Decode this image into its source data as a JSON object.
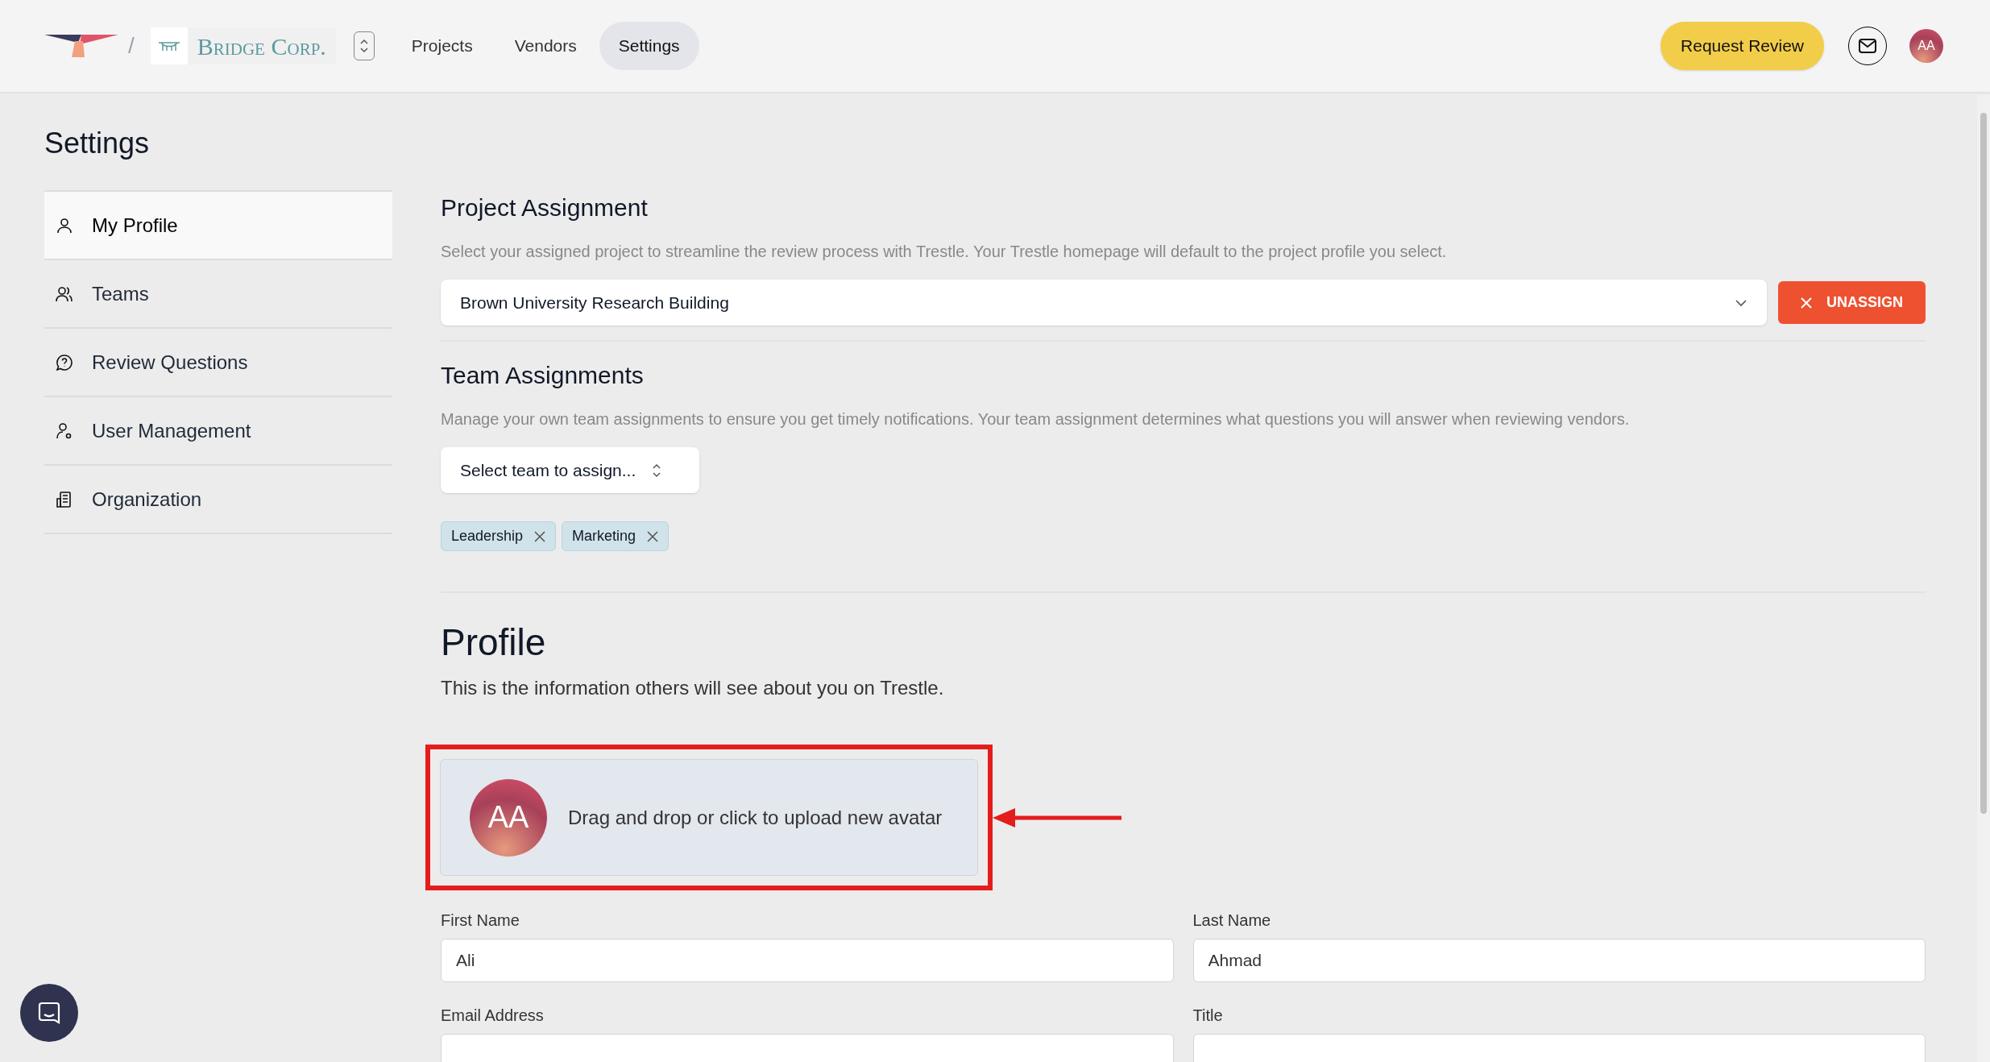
{
  "header": {
    "org_name": "Bridge Corp.",
    "breadcrumb_separator": "/",
    "nav": [
      {
        "label": "Projects",
        "selected": false
      },
      {
        "label": "Vendors",
        "selected": false
      },
      {
        "label": "Settings",
        "selected": true
      }
    ],
    "request_button": "Request Review",
    "avatar_initials": "AA"
  },
  "sidebar": {
    "title": "Settings",
    "items": [
      {
        "label": "My Profile",
        "selected": true
      },
      {
        "label": "Teams",
        "selected": false
      },
      {
        "label": "Review Questions",
        "selected": false
      },
      {
        "label": "User Management",
        "selected": false
      },
      {
        "label": "Organization",
        "selected": false
      }
    ]
  },
  "project_assignment": {
    "title": "Project Assignment",
    "description": "Select your assigned project to streamline the review process with Trestle. Your Trestle homepage will default to the project profile you select.",
    "value": "Brown University Research Building",
    "unassign_button": "UNASSIGN"
  },
  "team_assignments": {
    "title": "Team Assignments",
    "description": "Manage your own team assignments to ensure you get timely notifications. Your team assignment determines what questions you will answer when reviewing vendors.",
    "select_label": "Select team to assign...",
    "tags": [
      {
        "label": "Leadership"
      },
      {
        "label": "Marketing"
      }
    ]
  },
  "profile": {
    "title": "Profile",
    "description": "This is the information others will see about you on Trestle.",
    "avatar_initials": "AA",
    "upload_text": "Drag and drop or click to upload new avatar",
    "fields": [
      {
        "label": "First Name",
        "value": "Ali"
      },
      {
        "label": "Last Name",
        "value": "Ahmad"
      },
      {
        "label": "Email Address"
      },
      {
        "label": "Title"
      }
    ]
  }
}
